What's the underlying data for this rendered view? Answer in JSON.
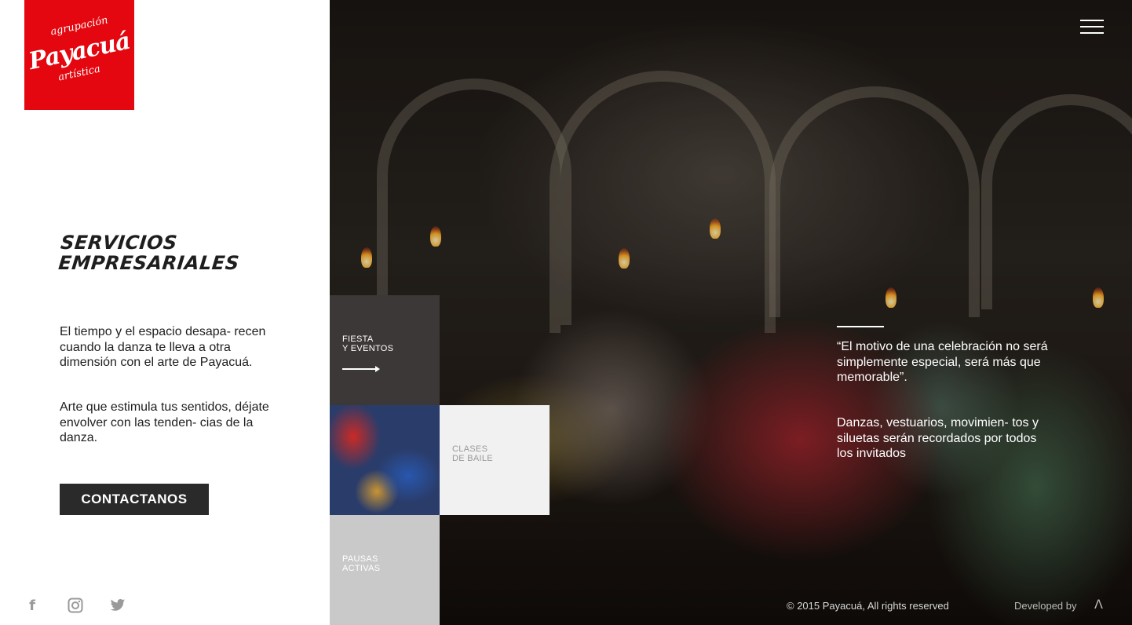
{
  "logo": {
    "top": "agrupación",
    "main": "Payacuá",
    "bottom": "artística",
    "color": "#e4070f"
  },
  "left": {
    "title_line1": "Servicios",
    "title_line2": "Empresariales",
    "paragraph1": "El tiempo y el espacio desapa- recen cuando la danza te lleva a otra dimensión con el arte de Payacuá.",
    "paragraph2": "Arte que estimula tus sentidos, déjate envolver con las tenden- cias de la danza.",
    "contact_label": "CONTACTANOS",
    "social": [
      "facebook-icon",
      "instagram-icon",
      "twitter-icon"
    ]
  },
  "header": {
    "menu_icon": "hamburger-menu-icon"
  },
  "tiles": {
    "fiesta_line1": "FIESTA",
    "fiesta_line2": "Y EVENTOS",
    "clases_line1": "CLASES",
    "clases_line2": "DE BAILE",
    "pausas_line1": "PAUSAS",
    "pausas_line2": "ACTIVAS"
  },
  "quote": {
    "text": "“El motivo de una celebración no será simplemente especial, será más que memorable”.",
    "detail": "Danzas, vestuarios, movimien- tos y siluetas serán recordados por todos los invitados"
  },
  "footer": {
    "copyright": "© 2015 Payacuá, All rights reserved",
    "developed_by": "Developed by",
    "developer_logo": "Λ"
  }
}
